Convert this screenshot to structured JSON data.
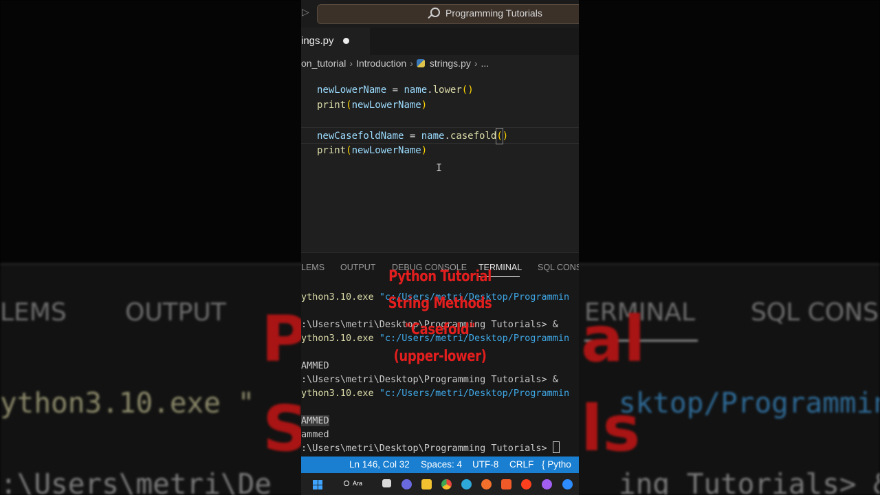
{
  "title_bar": {
    "search_label": "Programming Tutorials"
  },
  "editor_tab": {
    "filename": "ings.py"
  },
  "breadcrumb": [
    "on_tutorial",
    "Introduction",
    "strings.py",
    "..."
  ],
  "code_lines": [
    [
      {
        "t": "newLowerName",
        "c": "var"
      },
      {
        "t": " = ",
        "c": "op"
      },
      {
        "t": "name",
        "c": "var"
      },
      {
        "t": ".",
        "c": "op"
      },
      {
        "t": "lower",
        "c": "fn"
      },
      {
        "t": "()",
        "c": "paren"
      }
    ],
    [
      {
        "t": "print",
        "c": "fn"
      },
      {
        "t": "(",
        "c": "paren"
      },
      {
        "t": "newLowerName",
        "c": "var"
      },
      {
        "t": ")",
        "c": "paren"
      }
    ],
    [],
    [
      {
        "t": "newCasefoldName",
        "c": "var"
      },
      {
        "t": " = ",
        "c": "op"
      },
      {
        "t": "name",
        "c": "var"
      },
      {
        "t": ".",
        "c": "op"
      },
      {
        "t": "casefold",
        "c": "fn"
      },
      {
        "t": "(",
        "c": "box"
      },
      {
        "t": ")",
        "c": "paren"
      }
    ],
    [
      {
        "t": "print",
        "c": "fn"
      },
      {
        "t": "(",
        "c": "paren"
      },
      {
        "t": "newLowerName",
        "c": "var"
      },
      {
        "t": ")",
        "c": "paren"
      }
    ]
  ],
  "panel_tabs": [
    "LEMS",
    "OUTPUT",
    "DEBUG CONSOLE",
    "TERMINAL",
    "SQL CONS"
  ],
  "active_panel_tab": "TERMINAL",
  "terminal_lines": [
    [
      {
        "t": "ython3.10.exe ",
        "c": "yellow"
      },
      {
        "t": "\"c:/Users/metri/Desktop/Programmin",
        "c": "blue"
      }
    ],
    [],
    [
      {
        "t": ":\\Users\\metri\\Desktop\\Programming Tutorials> &",
        "c": "white"
      }
    ],
    [
      {
        "t": "ython3.10.exe ",
        "c": "yellow"
      },
      {
        "t": "\"c:/Users/metri/Desktop/Programmin",
        "c": "blue"
      }
    ],
    [],
    [
      {
        "t": "AMMED",
        "c": "white"
      }
    ],
    [
      {
        "t": ":\\Users\\metri\\Desktop\\Programming Tutorials> &",
        "c": "white"
      }
    ],
    [
      {
        "t": "ython3.10.exe ",
        "c": "yellow"
      },
      {
        "t": "\"c:/Users/metri/Desktop/Programmin",
        "c": "blue"
      }
    ],
    [],
    [
      {
        "t": "AMMED",
        "c": "hl"
      }
    ],
    [
      {
        "t": "ammed",
        "c": "white"
      }
    ],
    [
      {
        "t": ":\\Users\\metri\\Desktop\\Programming Tutorials> ",
        "c": "white"
      },
      {
        "t": "",
        "c": "cursor"
      }
    ]
  ],
  "overlay_lines": [
    "Python Tutorial",
    "String Methods",
    "\"Casefold\"",
    "(upper-lower)"
  ],
  "status_bar": {
    "position": "Ln 146, Col 32",
    "spaces": "Spaces: 4",
    "encoding": "UTF-8",
    "eol": "CRLF",
    "language": "{ Pytho"
  },
  "taskbar": {
    "search_label": "Ara",
    "apps": [
      "task-view-icon",
      "chat-icon",
      "file-explorer-icon",
      "chrome-icon",
      "edge-icon",
      "firefox-icon",
      "brave-icon",
      "yandex-icon",
      "purple-app-icon",
      "zoom-icon"
    ]
  },
  "colors": {
    "status_bar": "#1a7fd1",
    "overlay_text": "#e31e1e",
    "search_box": "#3b3129"
  }
}
